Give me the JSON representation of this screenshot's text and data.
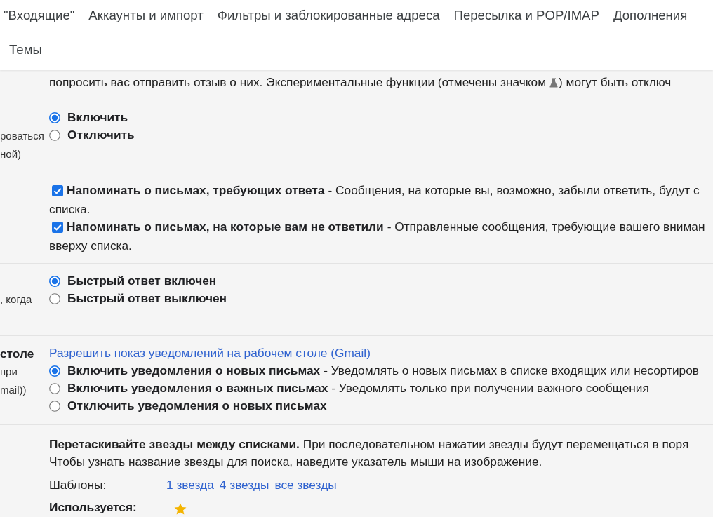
{
  "tab_rows": [
    [
      "\"Входящие\"",
      "Аккаунты и импорт",
      "Фильтры и заблокированные адреса",
      "Пересылка и POP/IMAP",
      "Дополнения"
    ],
    [
      "Темы"
    ]
  ],
  "sections": [
    {
      "kind": "note",
      "text_before_icon": "попросить вас отправить отзыв о них. Экспериментальные функции (отмечены значком",
      "text_after_icon": ") могут быть отключ"
    },
    {
      "kind": "radio_group",
      "side_label": {
        "lines": [
          "роваться",
          "ной)"
        ]
      },
      "options": [
        {
          "label": "Включить",
          "selected": true
        },
        {
          "label": "Отключить",
          "selected": false
        }
      ]
    },
    {
      "kind": "checkbox_list",
      "options": [
        {
          "label": "Напоминать о письмах, требующих ответа",
          "description": "- Сообщения, на которые вы, возможно, забыли ответить, будут с",
          "continuation": "списка.",
          "checked": true
        },
        {
          "label": "Напоминать о письмах, на которые вам не ответили",
          "description": "- Отправленные сообщения, требующие вашего вниман",
          "continuation": "вверху списка.",
          "checked": true
        }
      ]
    },
    {
      "kind": "radio_group",
      "side_label": {
        "lines": [
          ", когда"
        ]
      },
      "options": [
        {
          "label": "Быстрый ответ включен",
          "selected": true
        },
        {
          "label": "Быстрый ответ выключен",
          "selected": false
        }
      ]
    },
    {
      "kind": "radio_group",
      "side_label": {
        "title": "столе",
        "lines": [
          "при",
          "mail))"
        ]
      },
      "link": "Разрешить показ уведомлений на рабочем столе (Gmail)",
      "options": [
        {
          "label": "Включить уведомления о новых письмах",
          "description": "- Уведомлять о новых письмах в списке входящих или несортиров",
          "selected": true
        },
        {
          "label": "Включить уведомления о важных письмах",
          "description": "- Уведомлять только при получении важного сообщения",
          "selected": false
        },
        {
          "label": "Отключить уведомления о новых письмах",
          "selected": false
        }
      ]
    },
    {
      "kind": "stars",
      "intro": "**Перетаскивайте звезды между списками.** При последовательном нажатии звезды будут перемещаться в поря",
      "continuation": "Чтобы узнать название звезды для поиска, наведите указатель мыши на изображение.",
      "presets_label": "Шаблоны:",
      "presets": [
        "1 звезда",
        "4 звезды",
        "все звезды"
      ],
      "in_use_label": "Используется:",
      "in_use_stars": [
        {
          "color": "#f4b400"
        }
      ]
    }
  ]
}
